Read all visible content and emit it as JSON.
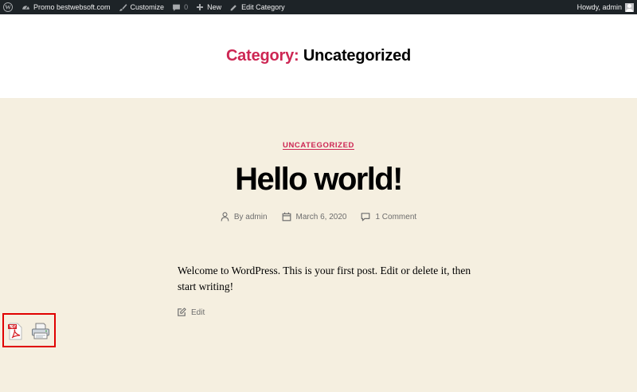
{
  "adminbar": {
    "wp_logo_icon": "wordpress-logo-icon",
    "site_name": "Promo bestwebsoft.com",
    "customize": "Customize",
    "comments_count": "0",
    "new_label": "New",
    "edit_category": "Edit Category",
    "howdy": "Howdy, admin"
  },
  "archive": {
    "prefix": "Category:",
    "name": "Uncategorized"
  },
  "post": {
    "category": "UNCATEGORIZED",
    "title": "Hello world!",
    "author": "By admin",
    "date": "March 6, 2020",
    "comments": "1 Comment",
    "content": "Welcome to WordPress. This is your first post. Edit or delete it, then start writing!",
    "edit": "Edit"
  },
  "tools": {
    "pdf_icon": "pdf-icon",
    "print_icon": "printer-icon",
    "highlight_color": "#e00000"
  },
  "colors": {
    "accent": "#cd2653",
    "admin_bar": "#1d2327",
    "page_bg": "#f5efe0"
  }
}
